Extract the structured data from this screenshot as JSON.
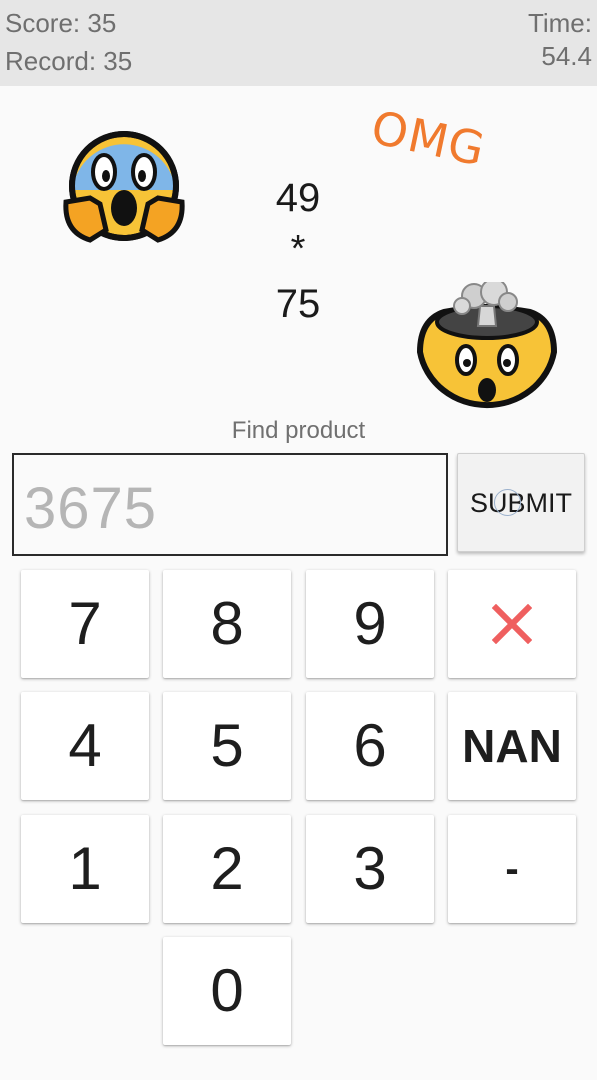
{
  "header": {
    "score": "Score: 35",
    "record": "Record: 35",
    "time_label": "Time:",
    "time_value": "54.4"
  },
  "decor": {
    "omg_text": "OMG",
    "emoji_left": "face-screaming-in-fear",
    "emoji_right": "exploding-head"
  },
  "problem": {
    "operand1": "49",
    "operator": "*",
    "operand2": "75"
  },
  "prompt": "Find product",
  "answer": {
    "value": "3675"
  },
  "submit_label": "SUBMIT",
  "keypad": {
    "k7": "7",
    "k8": "8",
    "k9": "9",
    "k4": "4",
    "k5": "5",
    "k6": "6",
    "k1": "1",
    "k2": "2",
    "k3": "3",
    "k0": "0",
    "nan": "NAN",
    "minus": "-",
    "clear_icon": "close-icon"
  },
  "colors": {
    "accent_orange": "#f07a2e",
    "clear_red": "#ef5f5f",
    "header_bg": "#e6e6e6"
  }
}
